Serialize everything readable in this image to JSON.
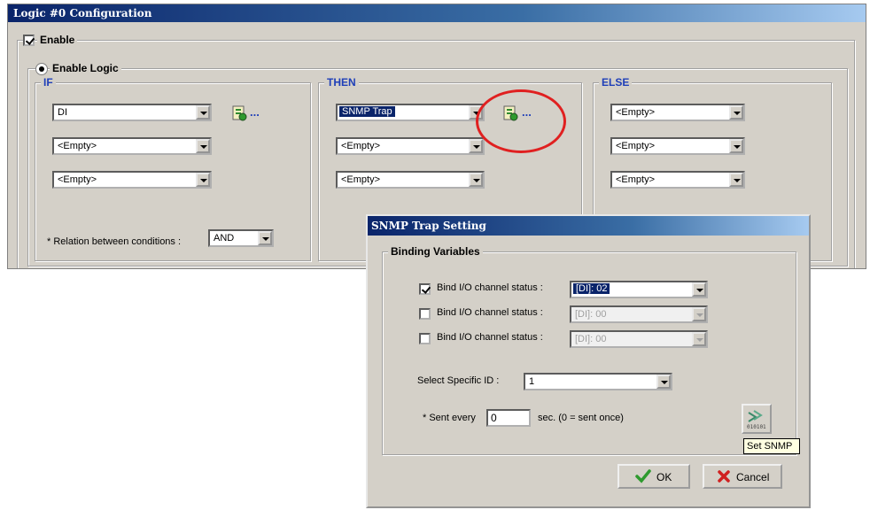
{
  "main_window": {
    "title": "Logic #0 Configuration",
    "enable_label": "Enable",
    "enable_logic_label": "Enable Logic",
    "if_group": {
      "label": "IF",
      "conditions": [
        "DI",
        "<Empty>",
        "<Empty>"
      ],
      "settings_dots": "..."
    },
    "then_group": {
      "label": "THEN",
      "actions": [
        "SNMP Trap",
        "<Empty>",
        "<Empty>"
      ],
      "settings_dots": "..."
    },
    "else_group": {
      "label": "ELSE",
      "actions": [
        "<Empty>",
        "<Empty>",
        "<Empty>"
      ]
    },
    "relation_label": "* Relation between conditions :",
    "relation_value": "AND"
  },
  "snmp_dialog": {
    "title": "SNMP Trap Setting",
    "group_label": "Binding Variables",
    "bind_rows": [
      {
        "label": "Bind I/O channel status :",
        "value": "[DI]: 02",
        "checked": true
      },
      {
        "label": "Bind I/O channel status :",
        "value": "[DI]: 00",
        "checked": false
      },
      {
        "label": "Bind I/O channel status :",
        "value": "[DI]: 00",
        "checked": false
      }
    ],
    "specific_id_label": "Select Specific ID :",
    "specific_id_value": "1",
    "sent_every_label": "* Sent every",
    "sent_every_value": "0",
    "sent_every_suffix": "sec. (0 = sent once)",
    "set_snmp_tooltip": "Set SNMP",
    "ok_label": "OK",
    "cancel_label": "Cancel"
  },
  "colors": {
    "titlebar": "#0a246a",
    "group_label_blue": "#1f3fb8",
    "highlight_circle": "#e02020",
    "ok_check": "#2e9a2e",
    "cancel_x": "#d02020"
  }
}
